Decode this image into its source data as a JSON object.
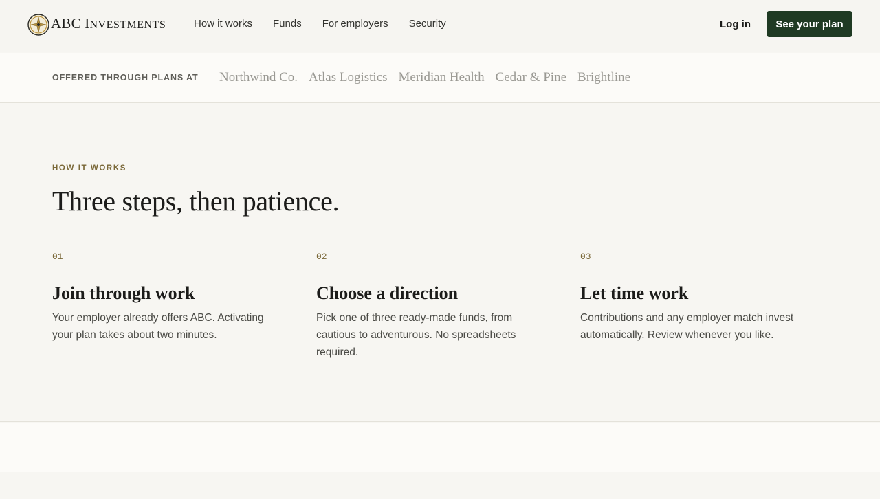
{
  "brand": {
    "name_initial": "A",
    "name_rest": "BC",
    "name_second_initial": "I",
    "name_second_rest": "NVESTMENTS",
    "logo_icon": "compass-seal-icon",
    "accent": "#1f3a23",
    "gold": "#c9ad72"
  },
  "nav": {
    "items": [
      {
        "label": "How it works"
      },
      {
        "label": "Funds"
      },
      {
        "label": "For employers"
      },
      {
        "label": "Security"
      }
    ],
    "login_label": "Log in",
    "cta_label": "See your plan"
  },
  "employers": {
    "label": "OFFERED THROUGH PLANS AT",
    "names": [
      "Northwind Co.",
      "Atlas Logistics",
      "Meridian Health",
      "Cedar & Pine",
      "Brightline"
    ]
  },
  "how_it_works": {
    "eyebrow": "HOW IT WORKS",
    "headline": "Three steps, then patience.",
    "steps": [
      {
        "number": "01",
        "title": "Join through work",
        "body": "Your employer already offers ABC. Activating your plan takes about two minutes."
      },
      {
        "number": "02",
        "title": "Choose a direction",
        "body": "Pick one of three ready-made funds, from cautious to adventurous. No spreadsheets required."
      },
      {
        "number": "03",
        "title": "Let time work",
        "body": "Contributions and any employer match invest automatically. Review whenever you like."
      }
    ]
  }
}
